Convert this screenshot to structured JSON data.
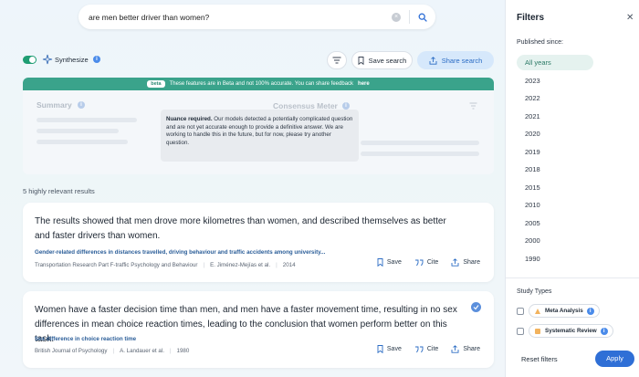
{
  "search": {
    "query": "are men better driver than women?"
  },
  "toolbar": {
    "synthesize_label": "Synthesize",
    "save_search_label": "Save search",
    "share_search_label": "Share search"
  },
  "synthesis": {
    "beta_tag": "beta",
    "beta_message": "These features are in Beta and not 100% accurate. You can share feedback",
    "beta_link": "here",
    "summary_label": "Summary",
    "meter_label": "Consensus Meter",
    "nuance_title": "Nuance required.",
    "nuance_text": "Our models detected a potentially complicated question and are not yet accurate enough to provide a definitive answer. We are working to handle this in the future, but for now, please try another question."
  },
  "results_count": "5 highly relevant results",
  "results": [
    {
      "claim": "The results showed that men drove more kilometres than women, and described themselves as better and faster drivers than women.",
      "paper_title": "Gender-related differences in distances travelled, driving behaviour and traffic accidents among university...",
      "journal": "Transportation Research Part F-traffic Psychology and Behaviour",
      "authors": "E. Jiménez-Mejías et al.",
      "year": "2014",
      "save_label": "Save",
      "cite_label": "Cite",
      "share_label": "Share"
    },
    {
      "claim": "Women have a faster decision time than men, and men have a faster movement time, resulting in no sex differences in mean choice reaction times, leading to the conclusion that women perform better on this task.",
      "paper_title": "Sex difference in choice reaction time",
      "journal": "British Journal of Psychology",
      "authors": "A. Landauer et al.",
      "year": "1980",
      "save_label": "Save",
      "cite_label": "Cite",
      "share_label": "Share"
    }
  ],
  "filters": {
    "title": "Filters",
    "published_since_label": "Published since:",
    "years": [
      "All years",
      "2023",
      "2022",
      "2021",
      "2020",
      "2019",
      "2018",
      "2015",
      "2010",
      "2005",
      "2000",
      "1990"
    ],
    "selected_year": "All years",
    "study_types_label": "Study Types",
    "study_types": [
      {
        "label": "Meta Analysis",
        "checked": false
      },
      {
        "label": "Systematic Review",
        "checked": false
      }
    ],
    "reset_label": "Reset filters",
    "apply_label": "Apply"
  },
  "colors": {
    "accent_green": "#3aa38b",
    "accent_blue": "#2f6fd6",
    "paper_title_blue": "#2a5d98"
  }
}
